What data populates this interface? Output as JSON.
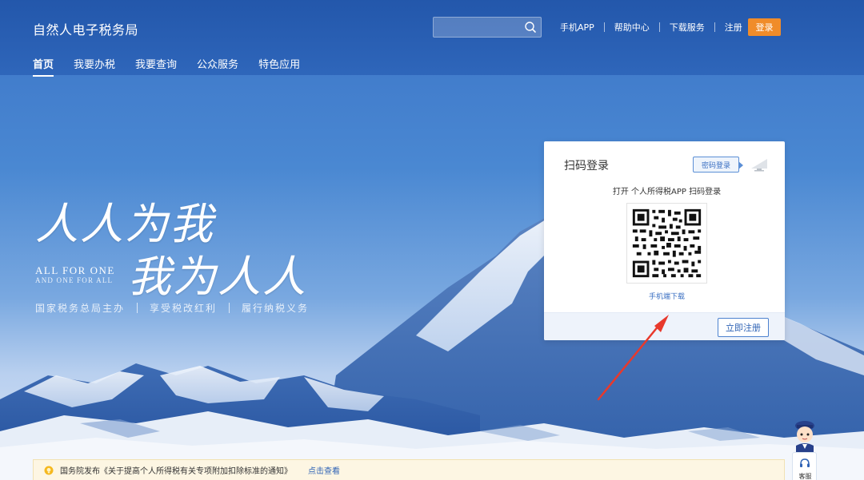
{
  "header": {
    "brand": "自然人电子税务局",
    "search": {
      "placeholder": ""
    },
    "links": [
      "手机APP",
      "帮助中心",
      "下载服务",
      "注册"
    ],
    "login": "登录"
  },
  "nav": {
    "tabs": [
      {
        "label": "首页",
        "active": true
      },
      {
        "label": "我要办税",
        "active": false
      },
      {
        "label": "我要查询",
        "active": false
      },
      {
        "label": "公众服务",
        "active": false
      },
      {
        "label": "特色应用",
        "active": false
      }
    ]
  },
  "hero": {
    "slogan_line1": "人人为我",
    "slogan_line2": "我为人人",
    "english_line1": "ALL FOR ONE",
    "english_line2": "AND ONE FOR ALL",
    "tagline": [
      "国家税务总局主办",
      "享受税改红利",
      "履行纳税义务"
    ]
  },
  "login_card": {
    "title": "扫码登录",
    "password_login": "密码登录",
    "scan_hint": "打开 个人所得税APP 扫码登录",
    "mobile_download": "手机端下载",
    "register": "立即注册"
  },
  "notice": {
    "text": "国务院发布《关于提高个人所得税有关专项附加扣除标准的通知》",
    "link": "点击查看"
  },
  "assistant": {
    "label": "客服"
  },
  "colors": {
    "accent": "#f08c2a",
    "primary": "#2f63b5",
    "header_bg": "#2a5db0"
  },
  "icons": [
    "search-icon",
    "monitor-icon",
    "qr-code",
    "lightbulb-icon",
    "headset-icon",
    "mascot-avatar"
  ]
}
